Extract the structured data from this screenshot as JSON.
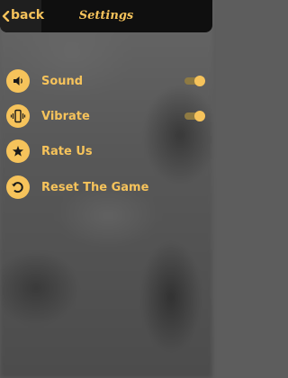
{
  "header": {
    "back_label": "back",
    "title": "Settings"
  },
  "settings": [
    {
      "label": "Sound",
      "icon": "speaker-icon",
      "toggle": true,
      "enabled": true
    },
    {
      "label": "Vibrate",
      "icon": "vibrate-icon",
      "toggle": true,
      "enabled": true
    },
    {
      "label": "Rate Us",
      "icon": "star-icon",
      "toggle": false
    },
    {
      "label": "Reset The Game",
      "icon": "reset-icon",
      "toggle": false
    }
  ],
  "colors": {
    "accent": "#f6c35b",
    "header_bg": "#0f0f0f",
    "toggle_track": "#8e7a43"
  }
}
